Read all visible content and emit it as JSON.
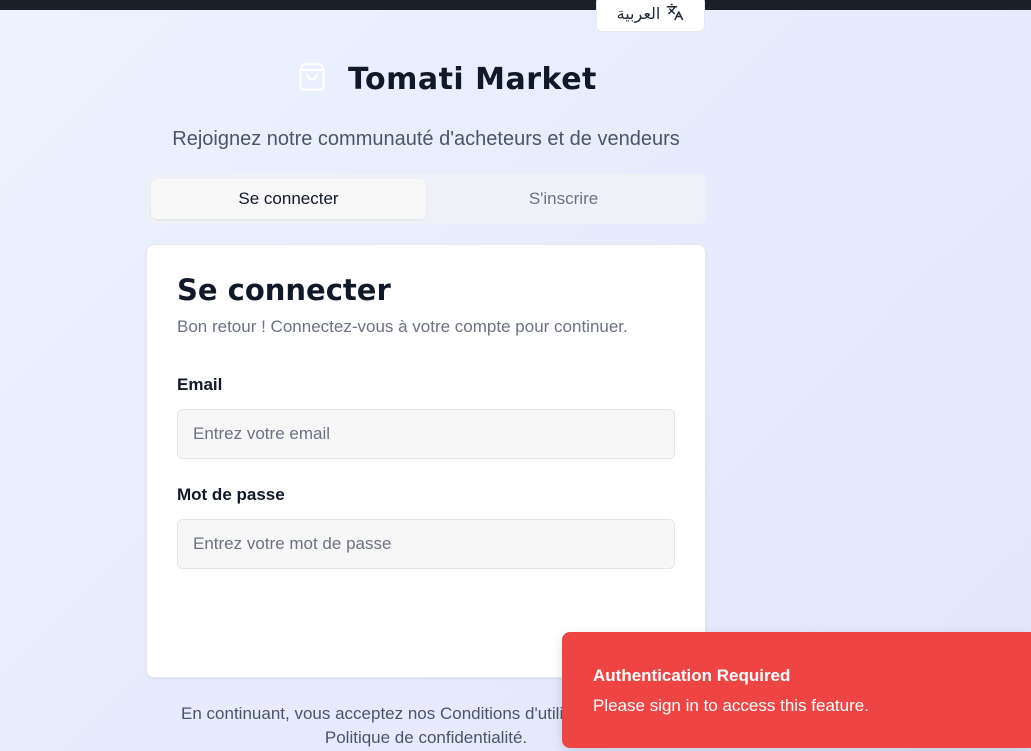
{
  "header": {
    "language_label": "العربية",
    "brand": "Tomati Market",
    "tagline": "Rejoignez notre communauté d'acheteurs et de vendeurs"
  },
  "tabs": [
    {
      "label": "Se connecter",
      "active": true
    },
    {
      "label": "S'inscrire",
      "active": false
    }
  ],
  "login": {
    "title": "Se connecter",
    "description": "Bon retour ! Connectez-vous à votre compte pour continuer.",
    "email_label": "Email",
    "email_placeholder": "Entrez votre email",
    "email_value": "",
    "password_label": "Mot de passe",
    "password_placeholder": "Entrez votre mot de passe",
    "password_value": ""
  },
  "footer": {
    "terms_line1": "En continuant, vous acceptez nos Conditions d'utilisation et notre",
    "terms_line2": "Politique de confidentialité."
  },
  "toast": {
    "title": "Authentication Required",
    "message": "Please sign in to access this feature.",
    "color": "#ef4444"
  },
  "icons": {
    "language": "translate-icon",
    "brand": "shopping-bag-icon"
  }
}
